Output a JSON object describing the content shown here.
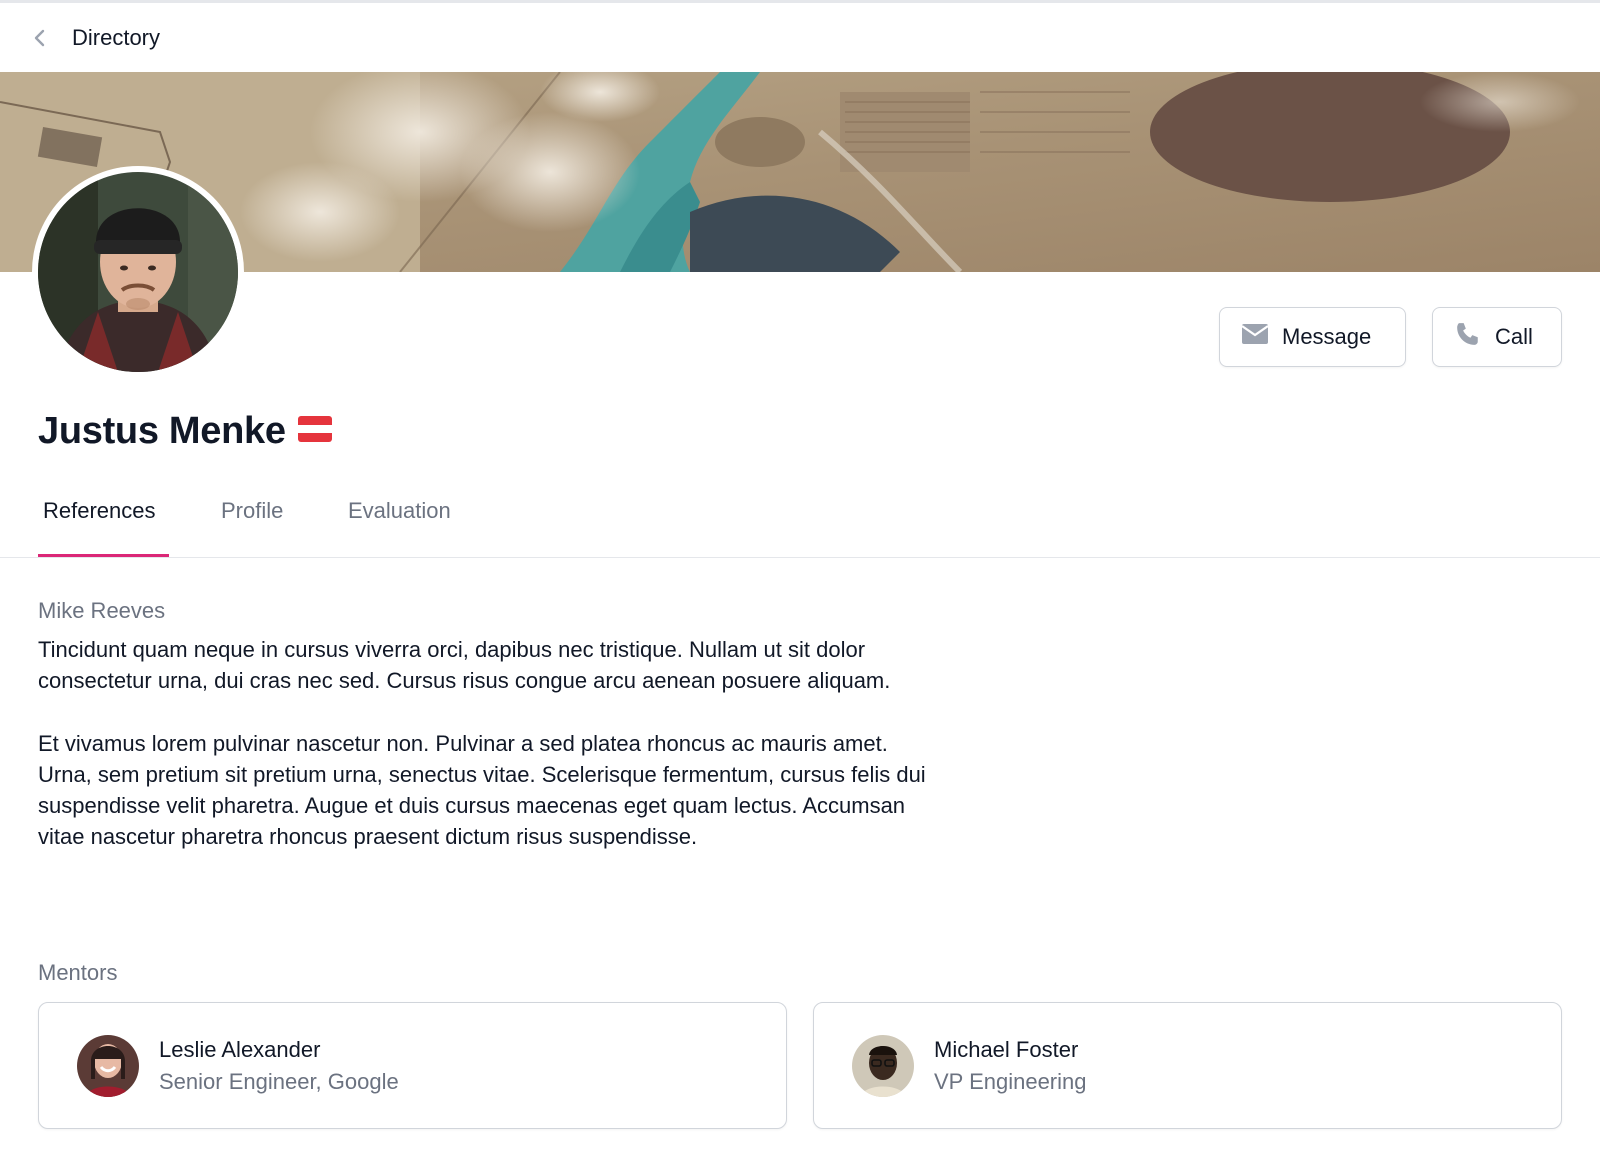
{
  "nav": {
    "back_label": "Directory"
  },
  "profile": {
    "name": "Justus Menke",
    "flag": "Austria flag",
    "actions": {
      "message_label": "Message",
      "call_label": "Call"
    }
  },
  "tabs": [
    {
      "label": "References",
      "active": true
    },
    {
      "label": "Profile",
      "active": false
    },
    {
      "label": "Evaluation",
      "active": false
    }
  ],
  "reference": {
    "author": "Mike Reeves",
    "paragraphs": [
      "Tincidunt quam neque in cursus viverra orci, dapibus nec tristique. Nullam ut sit dolor consectetur urna, dui cras nec sed. Cursus risus congue arcu aenean posuere aliquam.",
      "Et vivamus lorem pulvinar nascetur non. Pulvinar a sed platea rhoncus ac mauris amet. Urna, sem pretium sit pretium urna, senectus vitae. Scelerisque fermentum, cursus felis dui suspendisse velit pharetra. Augue et duis cursus maecenas eget quam lectus. Accumsan vitae nascetur pharetra rhoncus praesent dictum risus suspendisse."
    ]
  },
  "mentors": {
    "heading": "Mentors",
    "items": [
      {
        "name": "Leslie Alexander",
        "role": "Senior Engineer, Google"
      },
      {
        "name": "Michael Foster",
        "role": "VP Engineering"
      }
    ]
  },
  "colors": {
    "accent": "#db2777",
    "text": "#111827",
    "muted": "#6b7280",
    "border": "#d1d5db",
    "icon": "#9ca3af"
  },
  "icons": {
    "back": "chevron-left-icon",
    "message": "envelope-icon",
    "call": "phone-icon"
  }
}
